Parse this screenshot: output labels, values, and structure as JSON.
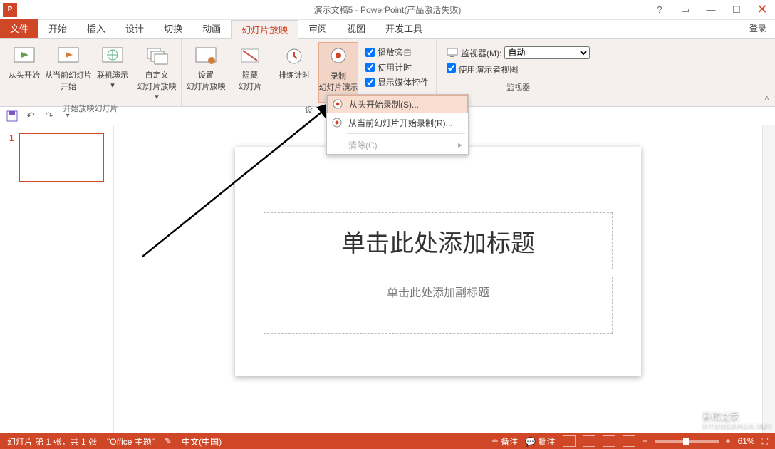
{
  "titlebar": {
    "title": "演示文稿5 - PowerPoint(产品激活失败)",
    "app_letter": "P"
  },
  "tabs": {
    "file": "文件",
    "items": [
      "开始",
      "插入",
      "设计",
      "切换",
      "动画",
      "幻灯片放映",
      "审阅",
      "视图",
      "开发工具"
    ],
    "active_index": 5,
    "login": "登录"
  },
  "ribbon": {
    "group1": {
      "label": "开始放映幻灯片",
      "btn1": "从头开始",
      "btn2": "从当前幻灯片\n开始",
      "btn3": "联机演示",
      "btn4": "自定义\n幻灯片放映"
    },
    "group2": {
      "label": "设",
      "btn5": "设置\n幻灯片放映",
      "btn6": "隐藏\n幻灯片",
      "btn7": "排练计时",
      "btn8": "录制\n幻灯片演示",
      "chk1": "播放旁白",
      "chk2": "使用计时",
      "chk3": "显示媒体控件"
    },
    "group3": {
      "label": "监视器",
      "mon_label": "监视器(M):",
      "mon_value": "自动",
      "presenter": "使用演示者视图"
    }
  },
  "dropdown": {
    "item1": "从头开始录制(S)...",
    "item2": "从当前幻灯片开始录制(R)...",
    "item3": "清除(C)"
  },
  "slide": {
    "num": "1",
    "title_ph": "单击此处添加标题",
    "sub_ph": "单击此处添加副标题"
  },
  "statusbar": {
    "slide_info": "幻灯片 第 1 张，共 1 张",
    "theme": "\"Office 主题\"",
    "lang": "中文(中国)",
    "notes": "备注",
    "comments": "批注",
    "zoom_minus": "−",
    "zoom_plus": "+",
    "zoom": "61%"
  },
  "watermark": {
    "text": "系统之家",
    "url": "XITONGZHIJIA.NET"
  }
}
